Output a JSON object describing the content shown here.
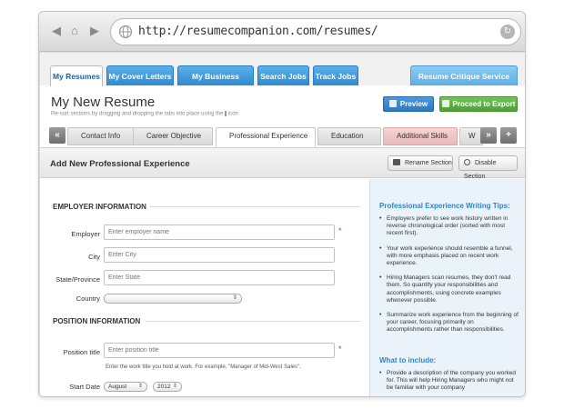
{
  "browser": {
    "url": "http://resumecompanion.com/resumes/"
  },
  "top_tabs": [
    {
      "label": "My Resumes",
      "active": true
    },
    {
      "label": "My Cover Letters",
      "active": false
    },
    {
      "label": "My Business Letters",
      "active": false
    },
    {
      "label": "Search Jobs",
      "active": false
    },
    {
      "label": "Track Jobs",
      "active": false
    }
  ],
  "critique_tab": "Resume Critique Service",
  "header": {
    "title": "My New Resume",
    "subtitle": "Re-sort sections by dragging and dropping the tabs into place using the",
    "subtitle_end": "icon",
    "preview_label": "Preview",
    "export_label": "Proceed to Export"
  },
  "section_tabs": [
    {
      "label": "Contact Info"
    },
    {
      "label": "Career Objective"
    },
    {
      "label": "Professional Experience"
    },
    {
      "label": "Education"
    },
    {
      "label": "Additional Skills"
    },
    {
      "label": "W"
    }
  ],
  "nav": {
    "prev": "«",
    "next": "»",
    "add": "+"
  },
  "section": {
    "title": "Add New Professional Experience",
    "rename_label": "Rename Section",
    "disable_label": "Disable Section"
  },
  "form": {
    "employer_heading": "EMPLOYER INFORMATION",
    "employer_label": "Employer",
    "employer_placeholder": "Enter employer name",
    "city_label": "City",
    "city_placeholder": "Enter City",
    "state_label": "State/Province",
    "state_placeholder": "Enter State",
    "country_label": "Country",
    "country_value": "",
    "position_heading": "POSITION INFORMATION",
    "position_label": "Position title",
    "position_placeholder": "Enter position title",
    "position_hint": "Enter the work title you hold at work. For example, \"Manager of Mid-West Sales\".",
    "start_label": "Start Date",
    "start_month": "August",
    "start_year": "2012",
    "required_mark": "*"
  },
  "tips": {
    "title": "Professional Experience Writing Tips:",
    "items": [
      "Employers prefer to see work history written in reverse chronological order (sorted with most recent first).",
      "Your work experience should resemble a funnel, with more emphasis placed on recent work experience.",
      "Hiring Managers scan resumes, they don't read them. So quantify your responsibilities and accomplishments, using concrete examples whenever possible.",
      "Summarize work experience from the beginning of your career, focusing primarily on accomplishments rather than responsibilities."
    ],
    "include_title": "What to include:",
    "include_items": [
      "Provide a description of the company you worked for. This will help Hiring Managers who might not be familiar with your company"
    ]
  },
  "colors": {
    "tab_blue": "#2e8ad1",
    "preview_blue": "#2b78c3",
    "export_green": "#4e9f34",
    "tips_heading": "#2a86cf",
    "tips_bg": "#ebf3fa"
  }
}
